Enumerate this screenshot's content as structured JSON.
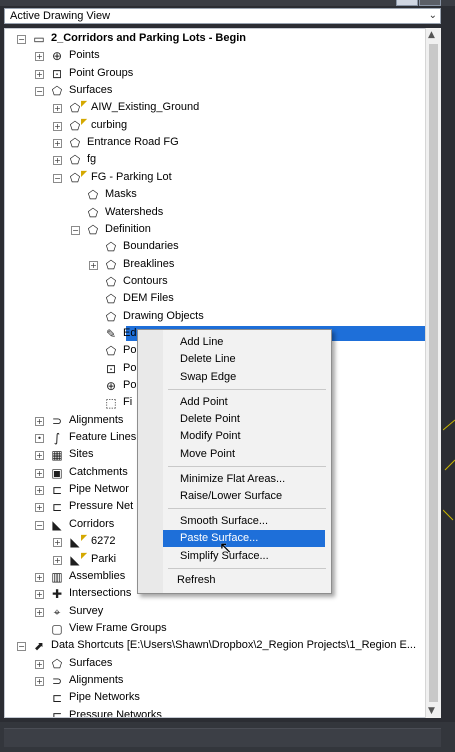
{
  "dropdown": {
    "value": "Active Drawing View"
  },
  "tree": [
    {
      "label": "2_Corridors and Parking Lots - Begin",
      "level": 0,
      "expander": "−",
      "icon": "▭",
      "icon_name": "drawing-icon",
      "bold": true
    },
    {
      "label": "Points",
      "level": 1,
      "expander": "+",
      "icon": "⊕",
      "icon_name": "points-icon"
    },
    {
      "label": "Point Groups",
      "level": 1,
      "expander": "+",
      "icon": "⊡",
      "icon_name": "point-groups-icon"
    },
    {
      "label": "Surfaces",
      "level": 1,
      "expander": "−",
      "icon": "⬠",
      "icon_name": "surfaces-icon"
    },
    {
      "label": "AIW_Existing_Ground",
      "level": 2,
      "expander": "+",
      "icon": "⬠",
      "icon_name": "surface-icon",
      "flag": true
    },
    {
      "label": "curbing",
      "level": 2,
      "expander": "+",
      "icon": "⬠",
      "icon_name": "surface-icon",
      "flag": true
    },
    {
      "label": "Entrance Road FG",
      "level": 2,
      "expander": "+",
      "icon": "⬠",
      "icon_name": "surface-icon"
    },
    {
      "label": "fg",
      "level": 2,
      "expander": "+",
      "icon": "⬠",
      "icon_name": "surface-icon"
    },
    {
      "label": "FG - Parking Lot",
      "level": 2,
      "expander": "−",
      "icon": "⬠",
      "icon_name": "surface-icon",
      "flag": true
    },
    {
      "label": "Masks",
      "level": 3,
      "expander": "",
      "icon": "⬠",
      "icon_name": "masks-icon"
    },
    {
      "label": "Watersheds",
      "level": 3,
      "expander": "",
      "icon": "⬠",
      "icon_name": "watersheds-icon"
    },
    {
      "label": "Definition",
      "level": 3,
      "expander": "−",
      "icon": "⬠",
      "icon_name": "definition-icon"
    },
    {
      "label": "Boundaries",
      "level": 4,
      "expander": "",
      "icon": "⬠",
      "icon_name": "boundaries-icon"
    },
    {
      "label": "Breaklines",
      "level": 4,
      "expander": "+",
      "icon": "⬠",
      "icon_name": "breaklines-icon"
    },
    {
      "label": "Contours",
      "level": 4,
      "expander": "",
      "icon": "⬠",
      "icon_name": "contours-icon"
    },
    {
      "label": "DEM Files",
      "level": 4,
      "expander": "",
      "icon": "⬠",
      "icon_name": "dem-files-icon"
    },
    {
      "label": "Drawing Objects",
      "level": 4,
      "expander": "",
      "icon": "⬠",
      "icon_name": "drawing-objects-icon"
    },
    {
      "label": "Ed",
      "level": 4,
      "expander": "",
      "icon": "✎",
      "icon_name": "edits-icon",
      "selected": true
    },
    {
      "label": "Po",
      "level": 4,
      "expander": "",
      "icon": "⬠",
      "icon_name": "point-files-icon"
    },
    {
      "label": "Po",
      "level": 4,
      "expander": "",
      "icon": "⊡",
      "icon_name": "point-groups-icon"
    },
    {
      "label": "Po",
      "level": 4,
      "expander": "",
      "icon": "⊕",
      "icon_name": "point-survey-icon"
    },
    {
      "label": "Fi",
      "level": 4,
      "expander": "",
      "icon": "⬚",
      "icon_name": "figures-icon"
    },
    {
      "label": "Alignments",
      "level": 1,
      "expander": "+",
      "icon": "⊃",
      "icon_name": "alignments-icon"
    },
    {
      "label": "Feature Lines",
      "level": 1,
      "expander": "•",
      "icon": "∫",
      "icon_name": "feature-lines-icon"
    },
    {
      "label": "Sites",
      "level": 1,
      "expander": "+",
      "icon": "▦",
      "icon_name": "sites-icon"
    },
    {
      "label": "Catchments",
      "level": 1,
      "expander": "+",
      "icon": "▣",
      "icon_name": "catchments-icon"
    },
    {
      "label": "Pipe Networ",
      "level": 1,
      "expander": "+",
      "icon": "⊏",
      "icon_name": "pipe-networks-icon"
    },
    {
      "label": "Pressure Net",
      "level": 1,
      "expander": "+",
      "icon": "⊏",
      "icon_name": "pressure-networks-icon"
    },
    {
      "label": "Corridors",
      "level": 1,
      "expander": "−",
      "icon": "◣",
      "icon_name": "corridors-icon"
    },
    {
      "label": "6272",
      "level": 2,
      "expander": "+",
      "icon": "◣",
      "icon_name": "corridor-icon",
      "flag": true
    },
    {
      "label": "Parki",
      "level": 2,
      "expander": "+",
      "icon": "◣",
      "icon_name": "corridor-icon",
      "flag": true
    },
    {
      "label": "Assemblies",
      "level": 1,
      "expander": "+",
      "icon": "▥",
      "icon_name": "assemblies-icon"
    },
    {
      "label": "Intersections",
      "level": 1,
      "expander": "+",
      "icon": "✚",
      "icon_name": "intersections-icon"
    },
    {
      "label": "Survey",
      "level": 1,
      "expander": "+",
      "icon": "⌖",
      "icon_name": "survey-icon"
    },
    {
      "label": "View Frame Groups",
      "level": 1,
      "expander": "",
      "icon": "▢",
      "icon_name": "view-frame-groups-icon"
    },
    {
      "label": "Data Shortcuts [E:\\Users\\Shawn\\Dropbox\\2_Region Projects\\1_Region E...",
      "level": 0,
      "expander": "−",
      "icon": "⬈",
      "icon_name": "data-shortcuts-icon"
    },
    {
      "label": "Surfaces",
      "level": 1,
      "expander": "+",
      "icon": "⬠",
      "icon_name": "surfaces-icon"
    },
    {
      "label": "Alignments",
      "level": 1,
      "expander": "+",
      "icon": "⊃",
      "icon_name": "alignments-icon"
    },
    {
      "label": "Pipe Networks",
      "level": 1,
      "expander": "",
      "icon": "⊏",
      "icon_name": "pipe-networks-icon"
    },
    {
      "label": "Pressure Networks",
      "level": 1,
      "expander": "",
      "icon": "⊏",
      "icon_name": "pressure-networks-icon"
    }
  ],
  "context_menu": {
    "items": [
      {
        "label": "Add Line"
      },
      {
        "label": "Delete Line"
      },
      {
        "label": "Swap Edge",
        "sep_after": true
      },
      {
        "label": "Add Point"
      },
      {
        "label": "Delete Point"
      },
      {
        "label": "Modify Point"
      },
      {
        "label": "Move Point",
        "sep_after": true
      },
      {
        "label": "Minimize Flat Areas..."
      },
      {
        "label": "Raise/Lower Surface",
        "sep_after": true
      },
      {
        "label": "Smooth Surface..."
      },
      {
        "label": "Paste Surface...",
        "highlighted": true
      },
      {
        "label": "Simplify Surface...",
        "sep_after": true
      },
      {
        "label": "Refresh",
        "shift_left": true
      }
    ]
  },
  "colors": {
    "selection": "#1e6fd9",
    "tree_background": "#ffffff",
    "dark_chrome": "#2b2d33",
    "flag": "#d4a800"
  }
}
